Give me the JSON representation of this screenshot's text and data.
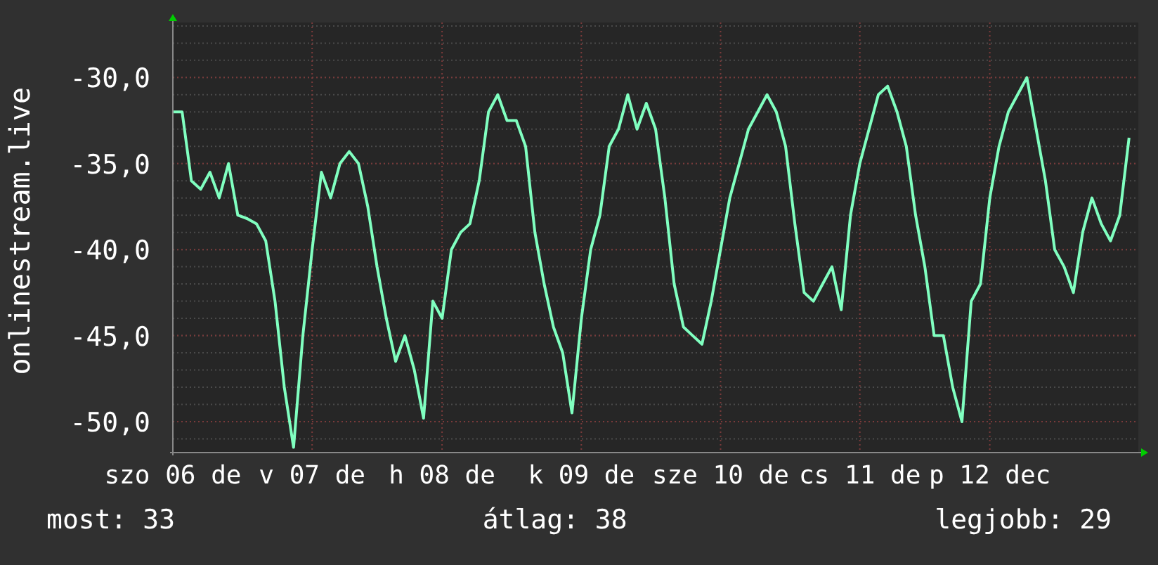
{
  "chart_data": {
    "type": "line",
    "grid": true,
    "ylabel": "onlinestream.live",
    "ylim": [
      -51.8,
      -26.8
    ],
    "yticks": [
      {
        "value": -30,
        "label": "-30,0"
      },
      {
        "value": -35,
        "label": "-35,0"
      },
      {
        "value": -40,
        "label": "-40,0"
      },
      {
        "value": -45,
        "label": "-45,0"
      },
      {
        "value": -50,
        "label": "-50,0"
      }
    ],
    "categories": [
      "szo 06 de",
      null,
      null,
      null,
      null,
      null,
      null,
      null,
      null,
      null,
      null,
      null,
      null,
      null,
      null,
      "v 07 de",
      null,
      null,
      null,
      null,
      null,
      null,
      null,
      null,
      null,
      null,
      null,
      null,
      null,
      "h 08 de",
      null,
      null,
      null,
      null,
      null,
      null,
      null,
      null,
      null,
      null,
      null,
      null,
      null,
      null,
      "k 09 de",
      null,
      null,
      null,
      null,
      null,
      null,
      null,
      null,
      null,
      null,
      null,
      null,
      null,
      null,
      "sze 10 de",
      null,
      null,
      null,
      null,
      null,
      null,
      null,
      null,
      null,
      null,
      null,
      null,
      null,
      null,
      "cs 11 de",
      null,
      null,
      null,
      null,
      null,
      null,
      null,
      null,
      null,
      null,
      null,
      null,
      null,
      "p 12 dec",
      null,
      null,
      null,
      null,
      null,
      null,
      null,
      null,
      null,
      null,
      null,
      null,
      null,
      null,
      null
    ],
    "series": [
      {
        "color": "#80ffc0",
        "values": [
          -32,
          -32,
          -36,
          -36.5,
          -35.5,
          -37,
          -35,
          -38,
          -38.2,
          -38.5,
          -39.5,
          -43,
          -48,
          -51.5,
          -45,
          -40,
          -35.5,
          -37,
          -35,
          -34.3,
          -35,
          -37.5,
          -41,
          -44,
          -46.5,
          -45,
          -47,
          -49.8,
          -43,
          -44,
          -40,
          -39,
          -38.5,
          -36,
          -32,
          -31,
          -32.5,
          -32.5,
          -34,
          -39,
          -42,
          -44.5,
          -46,
          -49.5,
          -44,
          -40,
          -38,
          -34,
          -33,
          -31,
          -33,
          -31.5,
          -33,
          -37,
          -42,
          -44.5,
          -45,
          -45.5,
          -43,
          -40,
          -37,
          -35,
          -33,
          -32,
          -31,
          -32,
          -34,
          -38.5,
          -42.5,
          -43,
          -42,
          -41,
          -43.5,
          -38,
          -35,
          -33,
          -31,
          -30.5,
          -32,
          -34,
          -38,
          -41,
          -45,
          -45,
          -48,
          -50,
          -43,
          -42,
          -37,
          -34,
          -32,
          -31,
          -30,
          -33,
          -36,
          -40,
          -41,
          -42.5,
          -39,
          -37,
          -38.5,
          -39.5,
          -38,
          -33.5
        ]
      }
    ]
  },
  "stats": [
    "most: 33",
    "átlag: 38",
    "legjobb: 29"
  ]
}
